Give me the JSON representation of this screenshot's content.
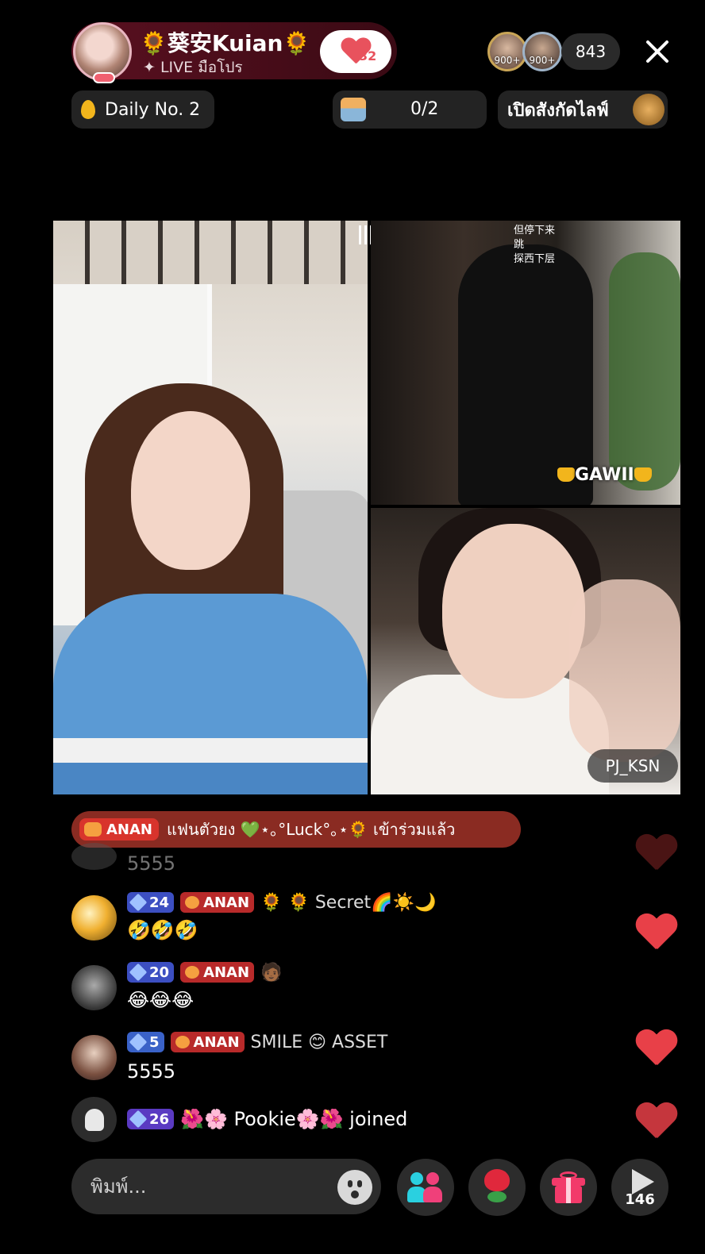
{
  "header": {
    "host_name": "🌻葵安Kuian🌻",
    "host_subtitle": "✦ LIVE มือโปร",
    "follow_count": "32",
    "viewer_badges": [
      "900+",
      "900+"
    ],
    "viewer_count": "843",
    "close_icon": "close-icon"
  },
  "subbar": {
    "daily_label": "Daily No. 2",
    "progress_text": "0/2",
    "live_label": "เปิดสังกัดไลฟ์"
  },
  "videos": {
    "top_caption": "但停下来\n跳\n探西下层",
    "top_label": "GAWII",
    "bottom_label": "PJ_KSN"
  },
  "join_banner": {
    "badge": "ANAN",
    "text": "แฟนตัวยง 💚⋆｡°Luck°｡⋆🌻 เข้าร่วมแล้ว"
  },
  "chat": [
    {
      "message": "5555",
      "faded": true
    },
    {
      "level": "24",
      "fan_badge": "ANAN",
      "username": "🌻 🌻 Secret🌈☀️🌙",
      "message": "🤣🤣🤣"
    },
    {
      "level": "20",
      "fan_badge": "ANAN",
      "username": "🧑🏾 ",
      "message": "😂😂😂"
    },
    {
      "level": "5",
      "fan_badge": "ANAN",
      "username": "SMILE 😊 ASSET",
      "message": "5555"
    },
    {
      "level": "26",
      "username": "🌺🌸 Pookie🌸🌺 joined"
    }
  ],
  "composer": {
    "placeholder": "พิมพ์...",
    "share_count": "146"
  },
  "colors": {
    "host_pill": "#4a0e1a",
    "fan_badge": "#b82a2a",
    "level_badge": "#3c4fc2",
    "heart": "#e84048"
  }
}
